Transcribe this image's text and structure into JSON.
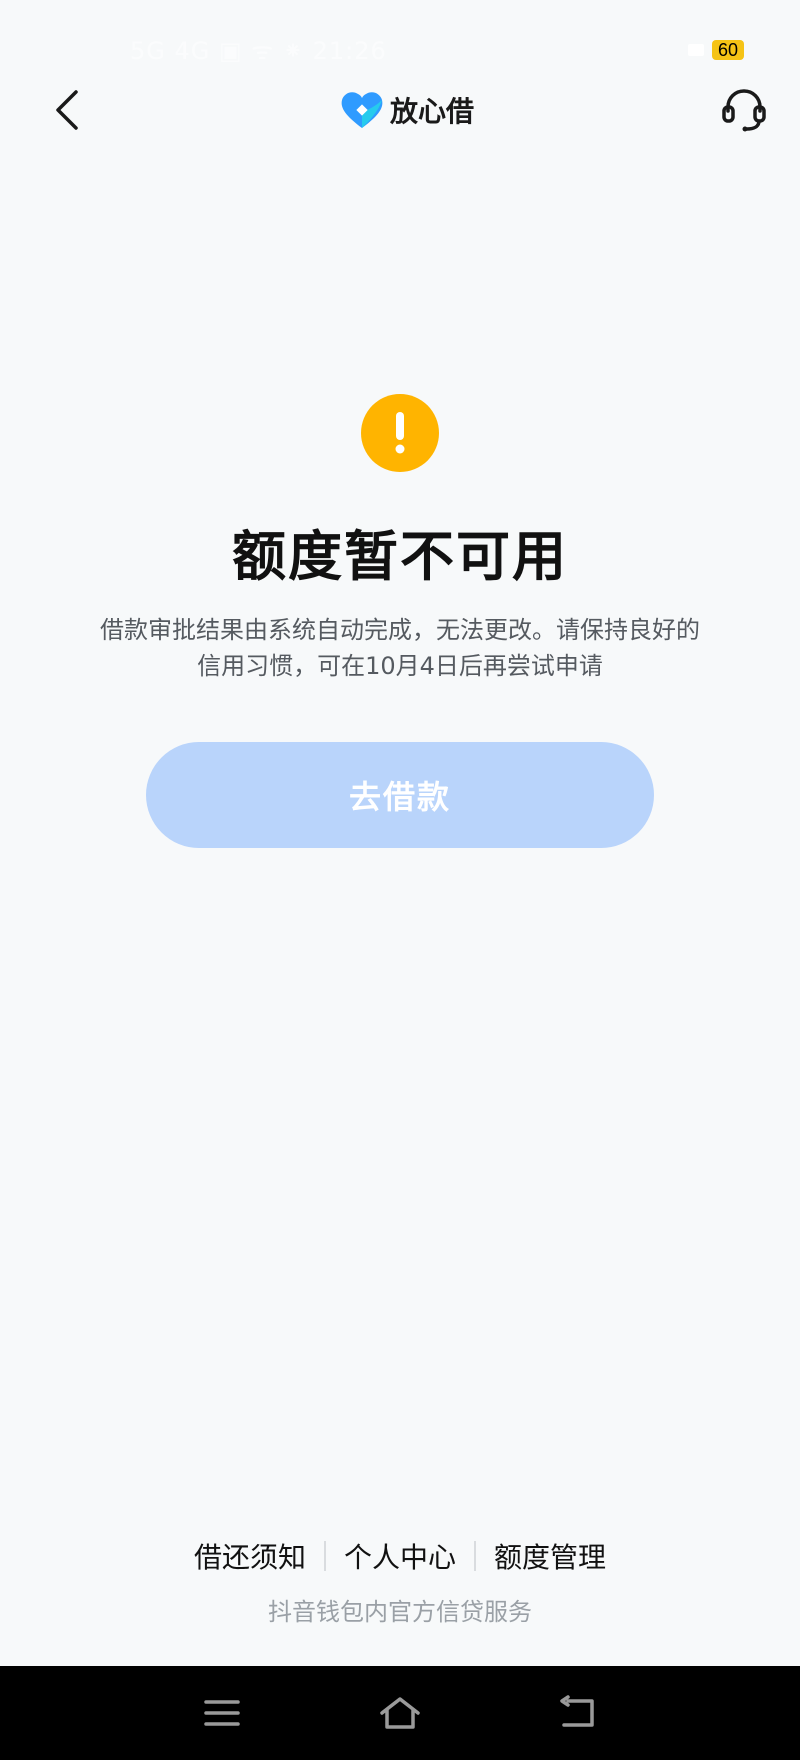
{
  "status_bar": {
    "left_text": "5G 4G ▣ ᯤ ⁕ 21:26",
    "battery": "60"
  },
  "header": {
    "brand_name": "放心借",
    "back_icon": "chevron-left-icon",
    "support_icon": "headset-icon",
    "brand_color": "#2f9bff"
  },
  "result": {
    "icon": "exclamation-icon",
    "icon_color": "#ffb400",
    "title": "额度暂不可用",
    "description": "借款审批结果由系统自动完成，无法更改。请保持良好的信用习惯，可在10月4日后再尝试申请",
    "button_label": "去借款",
    "button_color": "#b9d4fb"
  },
  "footer": {
    "links": [
      "借还须知",
      "个人中心",
      "额度管理"
    ],
    "note": "抖音钱包内官方信贷服务"
  },
  "system_nav": {
    "icons": [
      "menu-icon",
      "home-icon",
      "back-icon"
    ]
  }
}
